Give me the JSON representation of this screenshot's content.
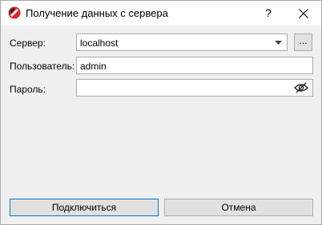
{
  "window": {
    "title": "Получение данных с сервера",
    "help_label": "?",
    "app_icon": "app-logo-icon",
    "close_icon": "close-icon"
  },
  "form": {
    "server_label": "Сервер:",
    "server_value": "localhost",
    "server_more_label": "...",
    "user_label": "Пользователь:",
    "user_value": "admin",
    "password_label": "Пароль:",
    "password_value": "",
    "password_toggle_icon": "eye-slash-icon"
  },
  "buttons": {
    "connect_label": "Подключиться",
    "cancel_label": "Отмена"
  },
  "colors": {
    "accent": "#0078d7",
    "logo_red": "#d9262c"
  }
}
